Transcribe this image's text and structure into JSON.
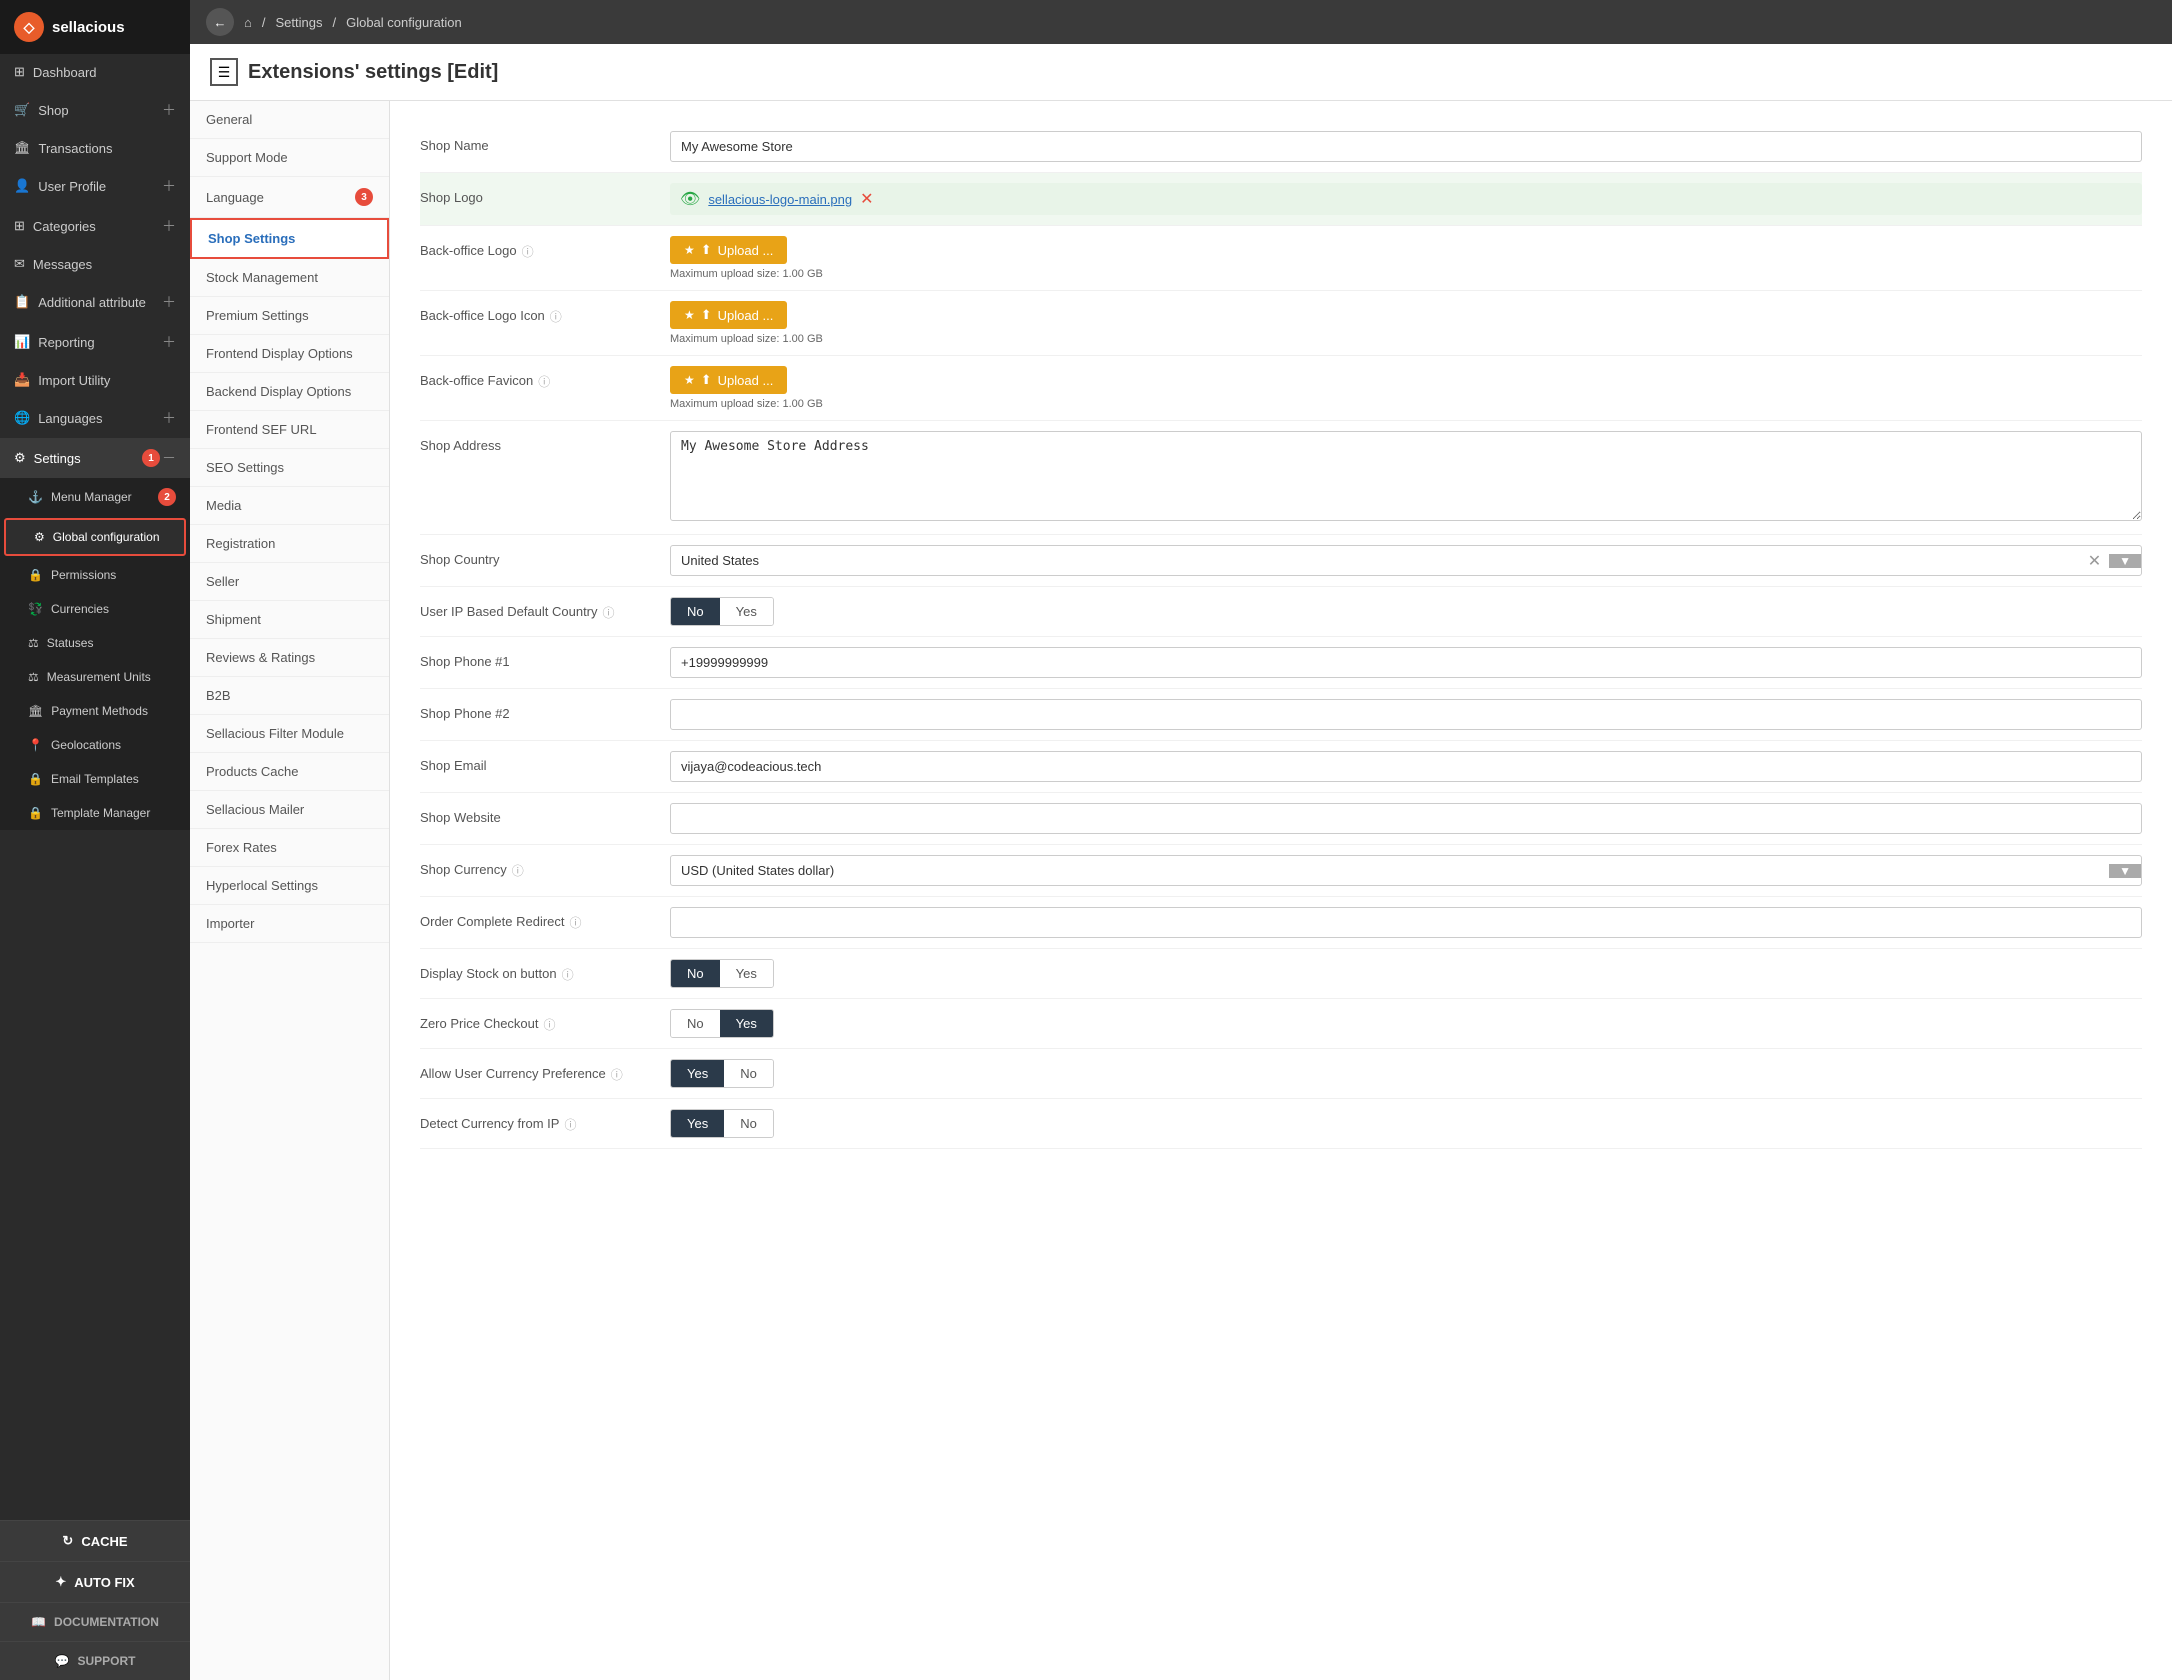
{
  "logo": {
    "text": "sellacious",
    "icon": "S"
  },
  "topbar": {
    "breadcrumb": "Settings / Global configuration",
    "home_icon": "⌂"
  },
  "page_title": "Extensions' settings [Edit]",
  "sidebar": {
    "items": [
      {
        "id": "dashboard",
        "label": "Dashboard",
        "icon": "⊞",
        "expandable": false
      },
      {
        "id": "shop",
        "label": "Shop",
        "icon": "🛒",
        "expandable": true
      },
      {
        "id": "transactions",
        "label": "Transactions",
        "icon": "🏛",
        "expandable": false
      },
      {
        "id": "user-profile",
        "label": "User Profile",
        "icon": "👤",
        "expandable": true
      },
      {
        "id": "categories",
        "label": "Categories",
        "icon": "⊞",
        "expandable": true
      },
      {
        "id": "messages",
        "label": "Messages",
        "icon": "✉",
        "expandable": false
      },
      {
        "id": "additional-attribute",
        "label": "Additional attribute",
        "icon": "📋",
        "expandable": true
      },
      {
        "id": "reporting",
        "label": "Reporting",
        "icon": "📊",
        "expandable": true
      },
      {
        "id": "import-utility",
        "label": "Import Utility",
        "icon": "📥",
        "expandable": false
      },
      {
        "id": "languages",
        "label": "Languages",
        "icon": "🌐",
        "expandable": true
      },
      {
        "id": "settings",
        "label": "Settings",
        "icon": "⚙",
        "expandable": true,
        "active": true,
        "badge": "1"
      }
    ],
    "submenu": [
      {
        "id": "menu-manager",
        "label": "Menu Manager",
        "icon": "⚓",
        "badge": "2"
      },
      {
        "id": "global-configuration",
        "label": "Global configuration",
        "icon": "⚙",
        "active": true
      },
      {
        "id": "permissions",
        "label": "Permissions",
        "icon": "🔒"
      },
      {
        "id": "currencies",
        "label": "Currencies",
        "icon": "💱"
      },
      {
        "id": "statuses",
        "label": "Statuses",
        "icon": "⚖"
      },
      {
        "id": "measurement-units",
        "label": "Measurement Units",
        "icon": "⚖"
      },
      {
        "id": "payment-methods",
        "label": "Payment Methods",
        "icon": "🏛"
      },
      {
        "id": "geolocations",
        "label": "Geolocations",
        "icon": "📍"
      },
      {
        "id": "email-templates",
        "label": "Email Templates",
        "icon": "🔒"
      },
      {
        "id": "template-manager",
        "label": "Template Manager",
        "icon": "🔒"
      }
    ],
    "bottom_buttons": [
      {
        "id": "cache",
        "label": "CACHE",
        "icon": "↻"
      },
      {
        "id": "auto-fix",
        "label": "AUTO FIX",
        "icon": "✦"
      },
      {
        "id": "documentation",
        "label": "DOCUMENTATION",
        "icon": "📖"
      },
      {
        "id": "support",
        "label": "SUPPORT",
        "icon": "💬"
      }
    ]
  },
  "left_nav": [
    {
      "id": "general",
      "label": "General"
    },
    {
      "id": "support-mode",
      "label": "Support Mode"
    },
    {
      "id": "language",
      "label": "Language",
      "badge": "3"
    },
    {
      "id": "shop-settings",
      "label": "Shop Settings",
      "active": true
    },
    {
      "id": "stock-management",
      "label": "Stock Management"
    },
    {
      "id": "premium-settings",
      "label": "Premium Settings"
    },
    {
      "id": "frontend-display",
      "label": "Frontend Display Options"
    },
    {
      "id": "backend-display",
      "label": "Backend Display Options"
    },
    {
      "id": "frontend-sef",
      "label": "Frontend SEF URL"
    },
    {
      "id": "seo-settings",
      "label": "SEO Settings"
    },
    {
      "id": "media",
      "label": "Media"
    },
    {
      "id": "registration",
      "label": "Registration"
    },
    {
      "id": "seller",
      "label": "Seller"
    },
    {
      "id": "shipment",
      "label": "Shipment"
    },
    {
      "id": "reviews-ratings",
      "label": "Reviews & Ratings"
    },
    {
      "id": "b2b",
      "label": "B2B"
    },
    {
      "id": "sellacious-filter",
      "label": "Sellacious Filter Module"
    },
    {
      "id": "products-cache",
      "label": "Products Cache"
    },
    {
      "id": "sellacious-mailer",
      "label": "Sellacious Mailer"
    },
    {
      "id": "forex-rates",
      "label": "Forex Rates"
    },
    {
      "id": "hyperlocal-settings",
      "label": "Hyperlocal Settings"
    },
    {
      "id": "importer",
      "label": "Importer"
    }
  ],
  "form": {
    "shop_name_label": "Shop Name",
    "shop_name_value": "My Awesome Store",
    "shop_logo_label": "Shop Logo",
    "shop_logo_filename": "sellacious-logo-main.png",
    "back_office_logo_label": "Back-office Logo",
    "back_office_logo_icon_label": "Back-office Logo Icon",
    "back_office_favicon_label": "Back-office Favicon",
    "upload_label": "Upload ...",
    "max_upload": "Maximum upload size: 1.00 GB",
    "shop_address_label": "Shop Address",
    "shop_address_value": "My Awesome Store Address",
    "shop_country_label": "Shop Country",
    "shop_country_value": "United States",
    "user_ip_label": "User IP Based Default Country",
    "user_ip_no": "No",
    "user_ip_yes": "Yes",
    "shop_phone1_label": "Shop Phone #1",
    "shop_phone1_value": "+19999999999",
    "shop_phone2_label": "Shop Phone #2",
    "shop_phone2_value": "",
    "shop_email_label": "Shop Email",
    "shop_email_value": "vijaya@codeacious.tech",
    "shop_website_label": "Shop Website",
    "shop_website_value": "",
    "shop_currency_label": "Shop Currency",
    "shop_currency_value": "USD (United States dollar)",
    "order_redirect_label": "Order Complete Redirect",
    "order_redirect_value": "",
    "display_stock_label": "Display Stock on button",
    "display_stock_no": "No",
    "display_stock_yes": "Yes",
    "zero_price_label": "Zero Price Checkout",
    "zero_price_no": "No",
    "zero_price_yes": "Yes",
    "allow_currency_label": "Allow User Currency Preference",
    "allow_currency_yes": "Yes",
    "allow_currency_no": "No",
    "detect_currency_label": "Detect Currency from IP",
    "detect_currency_yes": "Yes",
    "detect_currency_no": "No"
  }
}
